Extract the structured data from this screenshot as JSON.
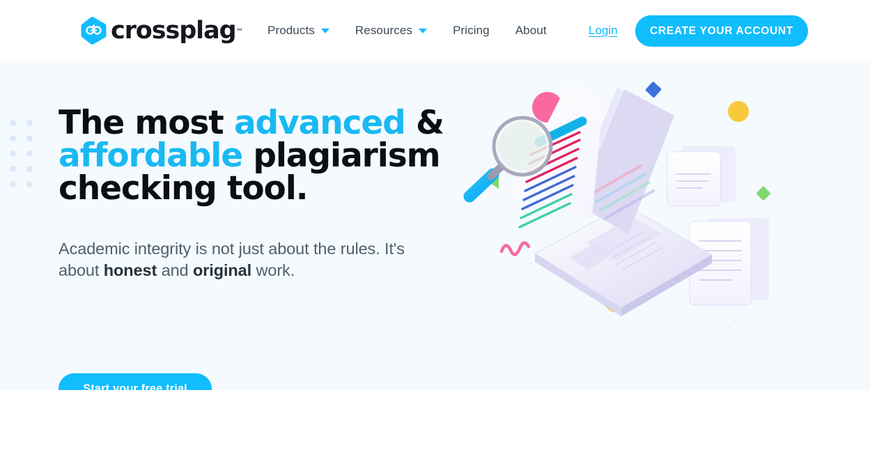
{
  "brand": {
    "name": "crossplag",
    "trademark": "™",
    "logo_icon": "crossplag-hexagon-logo",
    "accent_color": "#10bdfd",
    "headline_accent_color": "#19b9f2",
    "text_color": "#16181d"
  },
  "header": {
    "nav": [
      {
        "label": "Products",
        "has_caret": true,
        "caret_icon": "chevron-down-icon"
      },
      {
        "label": "Resources",
        "has_caret": true,
        "caret_icon": "chevron-down-icon"
      },
      {
        "label": "Pricing",
        "has_caret": false
      },
      {
        "label": "About",
        "has_caret": false
      }
    ],
    "login_label": "Login",
    "create_account_label": "CREATE YOUR ACCOUNT"
  },
  "hero": {
    "background_color": "#f4fafe",
    "headline": {
      "part1": "The most ",
      "accent1": "advanced",
      "part2": " &",
      "accent2": "affordable",
      "part3": " plagiarism",
      "part4": "checking tool."
    },
    "subhead": {
      "part1": "Academic integrity is not just about the rules. It's about ",
      "strong1": "honest",
      "part2": " and ",
      "strong2": "original",
      "part3": " work."
    },
    "cta_label": "Start your free trial",
    "decor_dots": {
      "icon": "dot-grid-decoration",
      "rows": 5,
      "cols": 2,
      "color": "#dce9fa"
    },
    "illustration": {
      "icon": "plagiarism-laptop-illustration",
      "description": "Isometric laptop displaying a document with colored text lines, a magnifying glass, floating paper documents and decorative shapes",
      "shapes": [
        {
          "name": "pink-circle",
          "color": "#f9699f"
        },
        {
          "name": "blue-diamond",
          "color": "#3c72e0"
        },
        {
          "name": "yellow-circle-top",
          "color": "#f8c93a"
        },
        {
          "name": "green-triangle",
          "color": "#7fd96a"
        },
        {
          "name": "green-diamond",
          "color": "#7fd96a"
        },
        {
          "name": "pink-squiggle",
          "color": "#f9699f"
        },
        {
          "name": "blue-dot",
          "color": "#2aa7ef"
        },
        {
          "name": "yellow-circle-bottom",
          "color": "#f8c93a"
        }
      ],
      "document_line_colors": [
        "#12b2e8",
        "#e0245e",
        "#4169d8",
        "#3fd1a5"
      ]
    }
  }
}
